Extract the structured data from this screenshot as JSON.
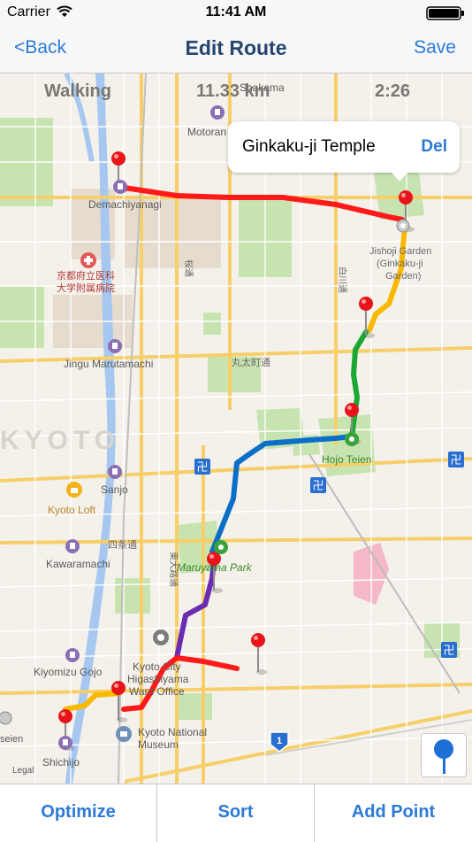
{
  "status_bar": {
    "carrier": "Carrier",
    "time": "11:41 AM"
  },
  "nav": {
    "back_label": "<Back",
    "title": "Edit Route",
    "save_label": "Save"
  },
  "route_summary": {
    "mode": "Walking",
    "distance": "11.33 km",
    "duration": "2:26"
  },
  "callout": {
    "name": "Ginkaku-ji Temple",
    "delete_label": "Del"
  },
  "map_labels": {
    "shukugawa": "Shakama",
    "motoran": "Motoran",
    "demachiyanagi": "Demachiyanagi",
    "jishoji": "Jishoji Garden",
    "ginkakuji_garden": "(Ginkaku-ji",
    "garden_word": "Garden)",
    "hospital": "京都府立医科",
    "hospital2": "大学附属病院",
    "jingu": "Jingu Marutamachi",
    "marutamachi_st": "丸太町通",
    "kyoto": "KYOTO",
    "hojo": "Hojo Teien",
    "sanjo": "Sanjo",
    "kyoto_loft": "Kyoto Loft",
    "shijo_st": "四条通",
    "kawaramachi": "Kawaramachi",
    "maruyama": "Maruyama Park",
    "higashi_oji": "東大路通",
    "kawabata": "白川通",
    "kyoto_city": "Kyoto City",
    "higashiyama": "Higashiyama",
    "ward_office": "Ward Office",
    "kiyomizu": "Kiyomizu Gojo",
    "museum1": "Kyoto National",
    "museum2": "Museum",
    "shichijo": "Shichijo",
    "legal": "Legal",
    "seien": "seien",
    "sakura": "桜通",
    "route_sign": "1"
  },
  "toolbar": {
    "optimize": "Optimize",
    "sort": "Sort",
    "add_point": "Add Point"
  },
  "colors": {
    "accent": "#2b7ad8",
    "route_red": "#ff1a1a",
    "route_yellow": "#f8b800",
    "route_green": "#1aa832",
    "route_blue": "#0b6fc8",
    "route_purple": "#6b2cb2"
  }
}
